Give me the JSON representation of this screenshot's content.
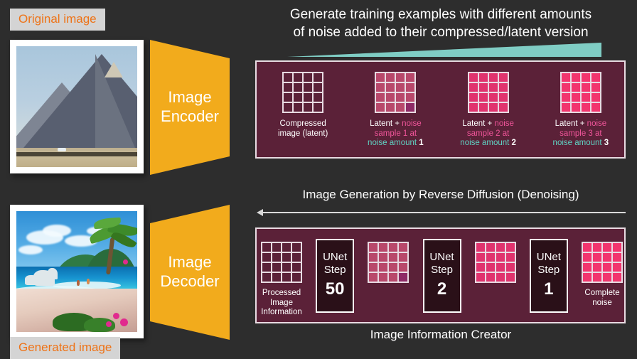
{
  "colors": {
    "background": "#2d2d2d",
    "panel": "#5b2138",
    "panel_border": "#e8dbe2",
    "trapezoid": "#f2ab1c",
    "tag_bg": "#d4d4d4",
    "tag_text": "#ee7317",
    "noise_pink": "#f0559a",
    "noise_amount_teal": "#5fd4c4",
    "wedge_teal": "#7fcdc4",
    "unet_box": "#2a1018",
    "latent_base": "#5b2138",
    "latent_noise_1": "#b8486b",
    "latent_noise_2": "#e0336e",
    "latent_noise_3": "#f2356e"
  },
  "top": {
    "original_image_tag": "Original image",
    "encoder_line1": "Image",
    "encoder_line2": "Encoder",
    "headline_line1": "Generate training examples with different amounts",
    "headline_line2": "of noise added to their compressed/latent version",
    "items": [
      {
        "id": "compressed-latent",
        "grid_fill": "#5b2138",
        "corner_cell": null,
        "caption_lines": [
          [
            {
              "t": "Compressed",
              "style": "plain"
            }
          ],
          [
            {
              "t": "image (latent)",
              "style": "plain"
            }
          ]
        ]
      },
      {
        "id": "latent-noise-sample-1",
        "grid_fill": "#b8486b",
        "corner_cell": "#8e2a66",
        "caption_lines": [
          [
            {
              "t": "Latent + ",
              "style": "plain"
            },
            {
              "t": "noise",
              "style": "noise"
            }
          ],
          [
            {
              "t": "sample 1 at",
              "style": "noise"
            }
          ],
          [
            {
              "t": "noise amount ",
              "style": "amount"
            },
            {
              "t": "1",
              "style": "num"
            }
          ]
        ]
      },
      {
        "id": "latent-noise-sample-2",
        "grid_fill": "#e0336e",
        "corner_cell": null,
        "caption_lines": [
          [
            {
              "t": "Latent + ",
              "style": "plain"
            },
            {
              "t": "noise",
              "style": "noise"
            }
          ],
          [
            {
              "t": "sample 2 at",
              "style": "noise"
            }
          ],
          [
            {
              "t": "noise amount ",
              "style": "amount"
            },
            {
              "t": "2",
              "style": "num"
            }
          ]
        ]
      },
      {
        "id": "latent-noise-sample-3",
        "grid_fill": "#f2356e",
        "corner_cell": null,
        "caption_lines": [
          [
            {
              "t": "Latent + ",
              "style": "plain"
            },
            {
              "t": "noise",
              "style": "noise"
            }
          ],
          [
            {
              "t": "sample 3 at",
              "style": "noise"
            }
          ],
          [
            {
              "t": "noise amount ",
              "style": "amount"
            },
            {
              "t": "3",
              "style": "num"
            }
          ]
        ]
      }
    ]
  },
  "bottom": {
    "generated_image_tag": "Generated image",
    "decoder_line1": "Image",
    "decoder_line2": "Decoder",
    "reverse_title": "Image Generation by Reverse Diffusion (Denoising)",
    "creator_title": "Image Information Creator",
    "sequence": [
      {
        "kind": "grid",
        "id": "processed-image-information",
        "grid_fill": "#5b2138",
        "corner_cell": null,
        "caption_lines": [
          "Processed",
          "Image",
          "Information"
        ],
        "caption_position": "below"
      },
      {
        "kind": "unet",
        "id": "unet-step-50",
        "line1": "UNet",
        "line2": "Step",
        "number": "50"
      },
      {
        "kind": "grid",
        "id": "latent-partially-denoised",
        "grid_fill": "#b8486b",
        "corner_cell": "#8e2a66",
        "caption_lines": [],
        "caption_position": "none"
      },
      {
        "kind": "unet",
        "id": "unet-step-2",
        "line1": "UNet",
        "line2": "Step",
        "number": "2"
      },
      {
        "kind": "grid",
        "id": "latent-noisy",
        "grid_fill": "#e0336e",
        "corner_cell": null,
        "caption_lines": [],
        "caption_position": "none"
      },
      {
        "kind": "unet",
        "id": "unet-step-1",
        "line1": "UNet",
        "line2": "Step",
        "number": "1"
      },
      {
        "kind": "grid",
        "id": "complete-noise",
        "grid_fill": "#f2356e",
        "corner_cell": null,
        "caption_lines": [
          "Complete",
          "noise"
        ],
        "caption_position": "below"
      }
    ]
  }
}
